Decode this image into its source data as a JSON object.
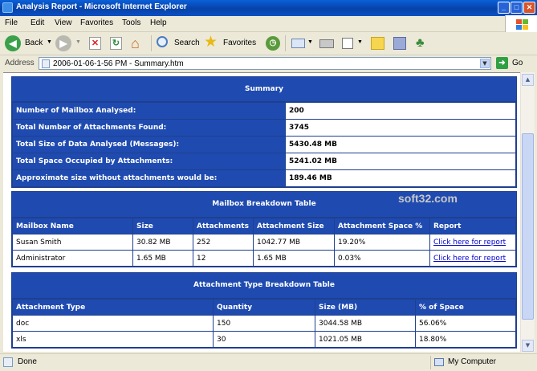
{
  "window": {
    "title": "Analysis Report - Microsoft Internet Explorer"
  },
  "menu": {
    "file": "File",
    "edit": "Edit",
    "view": "View",
    "favorites": "Favorites",
    "tools": "Tools",
    "help": "Help"
  },
  "toolbar": {
    "back": "Back",
    "search": "Search",
    "favorites": "Favorites"
  },
  "address": {
    "label": "Address",
    "value": "2006-01-06-1-56 PM - Summary.htm",
    "go": "Go"
  },
  "watermark": "soft32.com",
  "summary": {
    "title": "Summary",
    "rows": [
      {
        "label": "Number of Mailbox Analysed:",
        "value": "200"
      },
      {
        "label": "Total  Number of Attachments Found:",
        "value": "3745"
      },
      {
        "label": "Total Size of Data Analysed (Messages):",
        "value": "5430.48 MB"
      },
      {
        "label": "Total Space Occupied by Attachments:",
        "value": "5241.02 MB"
      },
      {
        "label": "Approximate size without attachments would be:",
        "value": "189.46 MB"
      }
    ]
  },
  "mailbox": {
    "title": "Mailbox Breakdown Table",
    "columns": [
      "Mailbox Name",
      "Size",
      "Attachments",
      "Attachment Size",
      "Attachment Space %",
      "Report"
    ],
    "rows": [
      [
        "Susan Smith",
        "30.82 MB",
        "252",
        "1042.77 MB",
        "19.20%",
        "Click here for report"
      ],
      [
        "Administrator",
        "1.65 MB",
        "12",
        "1.65 MB",
        "0.03%",
        "Click here for report"
      ]
    ]
  },
  "attachments": {
    "title": "Attachment Type Breakdown Table",
    "columns": [
      "Attachment Type",
      "Quantity",
      "Size (MB)",
      "% of Space"
    ],
    "rows": [
      [
        "doc",
        "150",
        "3044.58 MB",
        "56.06%"
      ],
      [
        "xls",
        "30",
        "1021.05 MB",
        "18.80%"
      ]
    ]
  },
  "status": {
    "left": "Done",
    "right": "My Computer"
  }
}
